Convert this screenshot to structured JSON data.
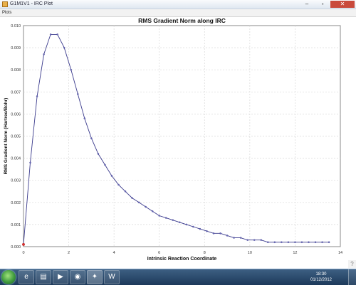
{
  "window": {
    "title": "G1M1V1 - IRC Plot",
    "minimize_glyph": "–",
    "maximize_glyph": "▫",
    "close_glyph": "✕"
  },
  "menubar": {
    "plots_label": "Plots"
  },
  "chart_data": {
    "type": "line",
    "title": "RMS Gradient Norm along IRC",
    "xlabel": "Intrinsic Reaction Coordinate",
    "ylabel": "RMS Gradient Norm (Hartree/Bohr)",
    "xlim": [
      0,
      14
    ],
    "ylim": [
      0,
      0.01
    ],
    "xticks": [
      "0",
      "2",
      "4",
      "6",
      "8",
      "10",
      "12",
      "14"
    ],
    "yticks": [
      "0.000",
      "0.001",
      "0.002",
      "0.003",
      "0.004",
      "0.005",
      "0.006",
      "0.007",
      "0.008",
      "0.009",
      "0.010"
    ],
    "grid": true,
    "line_color": "#3a3a8c",
    "series": [
      {
        "x": [
          0,
          0.3,
          0.6,
          0.9,
          1.2,
          1.5,
          1.8,
          2.1,
          2.4,
          2.7,
          3.0,
          3.3,
          3.6,
          3.9,
          4.2,
          4.5,
          4.8,
          5.1,
          5.4,
          5.7,
          6.0,
          6.3,
          6.6,
          6.9,
          7.2,
          7.5,
          7.8,
          8.1,
          8.4,
          8.7,
          9.0,
          9.3,
          9.6,
          9.9,
          10.2,
          10.5,
          10.8,
          11.1,
          11.4,
          11.7,
          12.0,
          12.3,
          12.6,
          12.9,
          13.2,
          13.5
        ],
        "y": [
          0.0001,
          0.0038,
          0.0068,
          0.0087,
          0.0096,
          0.0096,
          0.009,
          0.008,
          0.0069,
          0.0058,
          0.0049,
          0.0042,
          0.0037,
          0.0032,
          0.0028,
          0.0025,
          0.0022,
          0.002,
          0.0018,
          0.0016,
          0.0014,
          0.0013,
          0.0012,
          0.0011,
          0.001,
          0.0009,
          0.0008,
          0.0007,
          0.0006,
          0.0006,
          0.0005,
          0.0004,
          0.0004,
          0.0003,
          0.0003,
          0.0003,
          0.0002,
          0.0002,
          0.0002,
          0.0002,
          0.0002,
          0.0002,
          0.0002,
          0.0002,
          0.0002,
          0.0002
        ]
      }
    ]
  },
  "taskbar": {
    "clock_time": "18:30",
    "clock_date": "01/12/2012",
    "apps": [
      "ie-icon",
      "explorer-icon",
      "media-player-icon",
      "firefox-icon",
      "gaussview-icon",
      "word-icon"
    ]
  }
}
